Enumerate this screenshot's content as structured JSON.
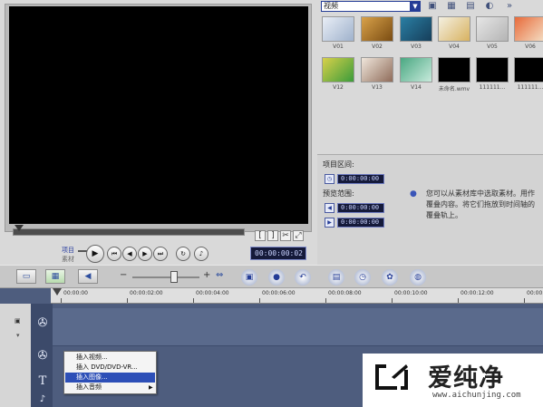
{
  "library": {
    "dropdown_value": "视频",
    "tools": [
      "folder-open-icon",
      "grid-view-icon",
      "library-manager-icon",
      "options-icon",
      "expand-icon"
    ],
    "thumbnails": [
      {
        "label": "V01",
        "colors": [
          "#e9eef6",
          "#9fb2cc"
        ]
      },
      {
        "label": "V02",
        "colors": [
          "#d9a24a",
          "#7a4c12"
        ]
      },
      {
        "label": "V03",
        "colors": [
          "#2a7fa4",
          "#163e5a"
        ]
      },
      {
        "label": "V04",
        "colors": [
          "#f4f0e2",
          "#d8b260"
        ]
      },
      {
        "label": "V05",
        "colors": [
          "#e6e6e6",
          "#b4b4b4"
        ]
      },
      {
        "label": "V06",
        "colors": [
          "#e86a3a",
          "#f4e1c7"
        ]
      },
      {
        "label": "V12",
        "colors": [
          "#d8d04a",
          "#3b9c3b"
        ]
      },
      {
        "label": "V13",
        "colors": [
          "#f0e7dc",
          "#8f6c5a"
        ]
      },
      {
        "label": "V14",
        "colors": [
          "#4aa882",
          "#c8eadc"
        ]
      },
      {
        "label": "未命名.wmv",
        "colors": [
          "#000000",
          "#000000"
        ]
      },
      {
        "label": "111111...",
        "colors": [
          "#000000",
          "#000000"
        ]
      },
      {
        "label": "111111...",
        "colors": [
          "#000000",
          "#000000"
        ]
      }
    ]
  },
  "player": {
    "mode_project": "项目",
    "mode_clip": "素材",
    "timecode": "00:00:00:02",
    "controls": [
      "play-icon",
      "home-icon",
      "previous-frame-icon",
      "next-frame-icon",
      "end-icon",
      "repeat-icon",
      "volume-icon"
    ],
    "trim_buttons": [
      "[",
      "]",
      "✂",
      "⤢"
    ]
  },
  "options": {
    "project_range_label": "项目区间:",
    "project_duration": "0:00:00:00",
    "preview_range_label": "预览范围:",
    "preview_start": "0:00:00:00",
    "preview_end": "0:00:00:00",
    "hint": "您可以从素材库中选取素材。用作覆叠内容。将它们拖放到时间轴的覆叠轨上。"
  },
  "toolbar": {
    "view_buttons": [
      "storyboard-view-icon",
      "timeline-view-icon",
      "audio-view-icon"
    ],
    "actions": [
      "insert-media-icon",
      "record-icon",
      "undo-icon",
      "redo-icon",
      "clip-editor-icon",
      "chapter-icon",
      "transition-icon",
      "title-icon"
    ]
  },
  "timeline": {
    "ruler": [
      "00:00:00",
      "00:00:02:00",
      "00:00:04:00",
      "00:00:06:00",
      "00:00:08:00",
      "00:00:10:00",
      "00:00:12:00",
      "00:00:14:0"
    ],
    "track_symbols": [
      "film-reel-icon",
      "overlay-icon",
      "title-track-icon",
      "audio-track-icon"
    ]
  },
  "context_menu": {
    "items": [
      {
        "label": "插入视频...",
        "selected": false,
        "submenu": false
      },
      {
        "label": "插入 DVD/DVD-VR...",
        "selected": false,
        "submenu": false
      },
      {
        "label": "插入图像...",
        "selected": true,
        "submenu": false
      },
      {
        "label": "插入音频",
        "selected": false,
        "submenu": true
      }
    ]
  },
  "watermark": {
    "title": "爱纯净",
    "url": "www.aichunjing.com"
  }
}
